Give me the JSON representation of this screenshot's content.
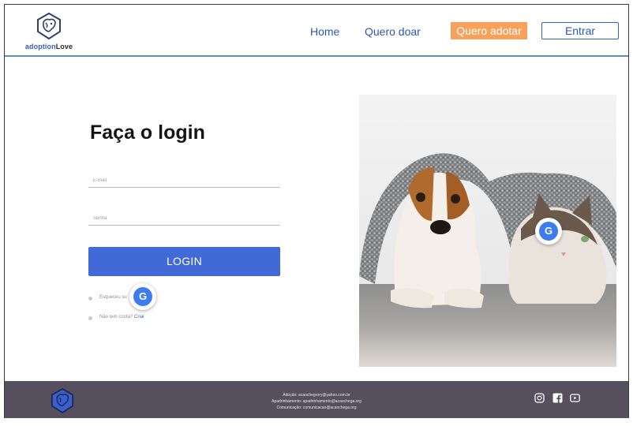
{
  "brand": {
    "name_part1": "adoption",
    "name_part2": "Love",
    "logo_icon": "dog-cat-logo-icon"
  },
  "nav": {
    "home": "Home",
    "donate": "Quero doar",
    "adopt": "Quero adotar",
    "login": "Entrar"
  },
  "login": {
    "title": "Faça o login",
    "email_placeholder": "E-mail",
    "password_placeholder": "Senha",
    "submit": "LOGIN",
    "forgot": "Esqueceu su",
    "no_account": "Não tem conta?",
    "create": "Criar"
  },
  "badges": {
    "letter": "G"
  },
  "photo": {
    "icon": "dog-and-cat-under-blanket-photo"
  },
  "footer": {
    "contact_lines": [
      "Adoção: acaochegrory@yahoo.com.br",
      "Apadrinhamento: apadrinhamento@acaochega.org",
      "Comunicação: comunicacao@acaochega.org"
    ],
    "social_icons": [
      "instagram-icon",
      "facebook-icon",
      "youtube-icon"
    ]
  },
  "colors": {
    "primary": "#4169d8",
    "accent": "#f6a25a",
    "footer": "#554f5e",
    "link": "#2d56b3"
  }
}
